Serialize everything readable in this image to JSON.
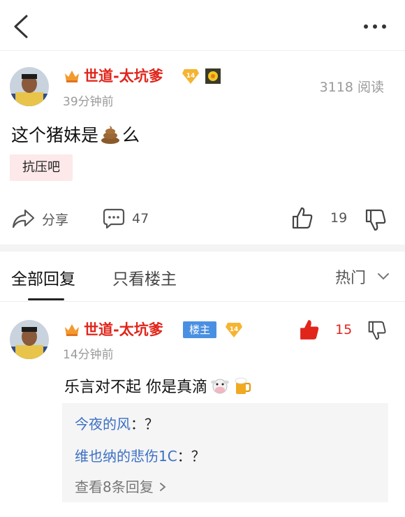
{
  "colors": {
    "username_red": "#e1251b",
    "owner_badge_blue": "#4a90e2",
    "link_blue": "#3b6fc4",
    "tag_bg": "#fde9ea"
  },
  "icons": [
    "back-icon",
    "more-icon",
    "crown-icon",
    "diamond-level-icon",
    "gold-medal-icon",
    "share-icon",
    "comment-icon",
    "thumbs-up-icon",
    "thumbs-down-icon",
    "chevron-down-icon",
    "poop-emoji",
    "cow-emoji",
    "beer-emoji"
  ],
  "post": {
    "username": "世道-太坑爹",
    "level": "14",
    "time": "39分钟前",
    "views": "3118 阅读",
    "text_before": "这个猪妹是",
    "text_after": "么",
    "tag": "抗压吧",
    "share_label": "分享",
    "comment_count": "47",
    "like_count": "19"
  },
  "tabs": {
    "all_replies": "全部回复",
    "owner_only": "只看楼主",
    "sort": "热门"
  },
  "reply": {
    "username": "世道-太坑爹",
    "owner_badge": "楼主",
    "level": "14",
    "time": "14分钟前",
    "like_count": "15",
    "text": "乐言对不起 你是真滴",
    "subreplies": [
      {
        "name": "今夜的风",
        "sep": "：",
        "text": "？"
      },
      {
        "name": "维也纳的悲伤1C",
        "sep": "：",
        "text": "？"
      }
    ],
    "view_more": "查看8条回复"
  }
}
